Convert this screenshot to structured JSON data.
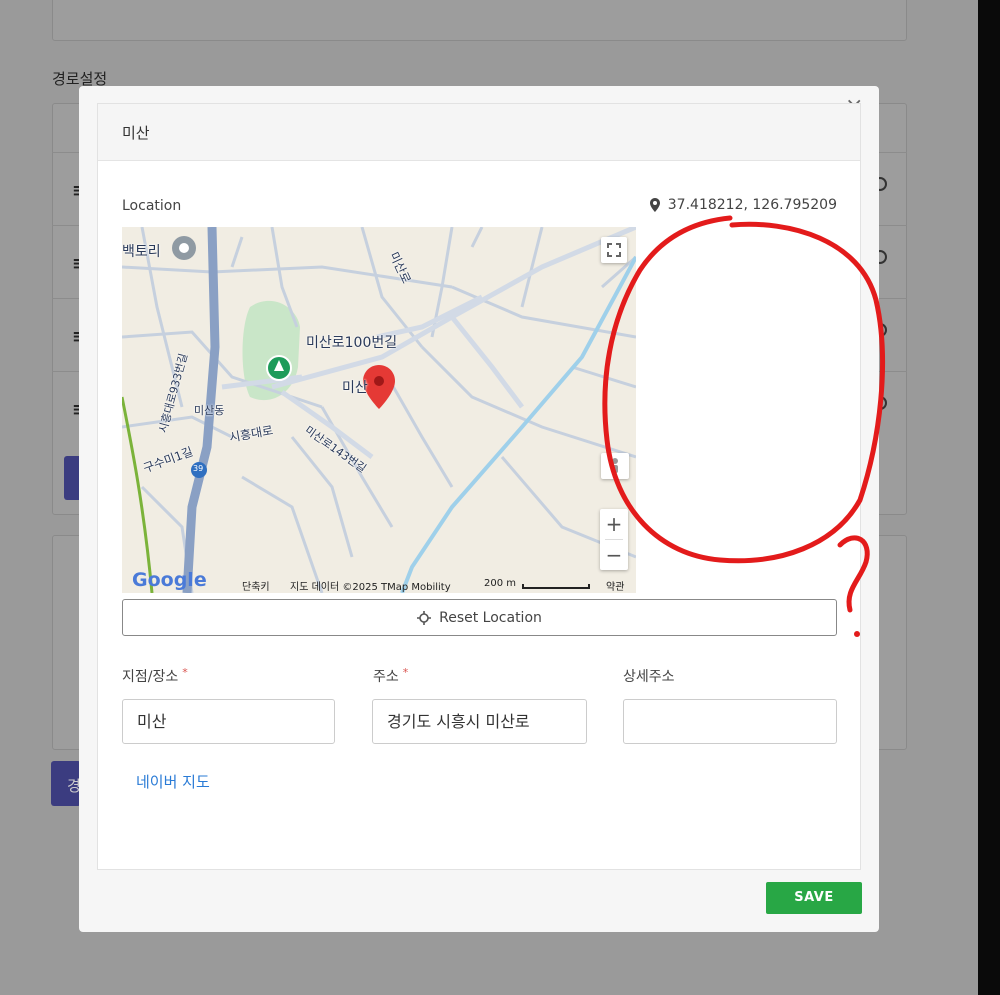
{
  "background": {
    "section_title": "경로설정",
    "bottom_button_label": "경"
  },
  "modal": {
    "title": "미산",
    "close_symbol": "×",
    "location_label": "Location",
    "coordinates": "37.418212, 126.795209",
    "reset_button_label": "Reset Location",
    "fields": {
      "place_label": "지점/장소",
      "place_value": "미산",
      "address_label": "주소",
      "address_value": "경기도 시흥시 미산로",
      "detail_label": "상세주소",
      "detail_value": "",
      "required_mark": "*"
    },
    "naver_link": "네이버 지도",
    "save_label": "SAVE"
  },
  "map": {
    "labels": {
      "poi_top": "백토리",
      "road_top": "미산로",
      "road_100": "미산로100번길",
      "pin_area": "미산",
      "siheungdaero_933": "시흥대로933번길",
      "misan_dong": "미산동",
      "siheungdaero": "시흥대로",
      "gusumi": "구수미1길",
      "misanro_143": "미산로143번길",
      "route_number": "39"
    },
    "attribution": {
      "logo": "Google",
      "shortcuts": "단축키",
      "data": "지도 데이터 ©2025 TMap Mobility",
      "scale": "200 m",
      "terms": "약관"
    },
    "zoom_in": "+",
    "zoom_out": "−"
  },
  "colors": {
    "save_green": "#28a745",
    "link_blue": "#2a7bd6",
    "pin_red": "#e53935",
    "annotation_red": "#e31b1b"
  }
}
